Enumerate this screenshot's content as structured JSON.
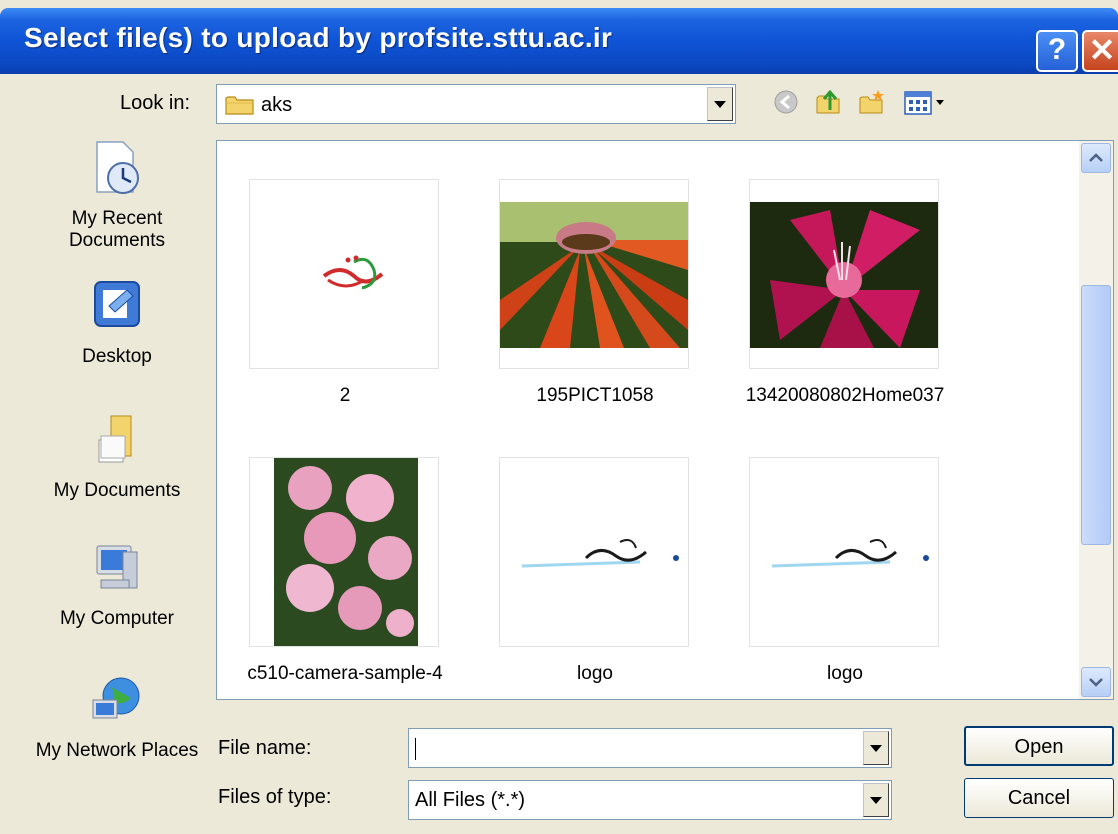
{
  "window": {
    "title": "Select file(s) to upload by profsite.sttu.ac.ir",
    "help_label": "?",
    "close_label": "✕"
  },
  "look_in": {
    "label": "Look in:",
    "value": "aks",
    "icon": "folder-icon"
  },
  "toolbar": {
    "icons": [
      "back-icon",
      "up-folder-icon",
      "new-folder-icon",
      "view-menu-icon"
    ]
  },
  "places": [
    {
      "label": "My Recent Documents",
      "icon": "recent-documents-icon"
    },
    {
      "label": "Desktop",
      "icon": "desktop-icon"
    },
    {
      "label": "My Documents",
      "icon": "my-documents-icon"
    },
    {
      "label": "My Computer",
      "icon": "my-computer-icon"
    },
    {
      "label": "My Network Places",
      "icon": "network-places-icon"
    }
  ],
  "files": [
    {
      "name": "2",
      "thumb": "logo-art"
    },
    {
      "name": "195PICT1058",
      "thumb": "orange-flower"
    },
    {
      "name": "13420080802Home037",
      "thumb": "pink-flower"
    },
    {
      "name": "c510-camera-sample-4",
      "thumb": "azalea"
    },
    {
      "name": "logo",
      "thumb": "logo-line"
    },
    {
      "name": "logo",
      "thumb": "logo-line"
    }
  ],
  "file_name": {
    "label": "File name:",
    "value": ""
  },
  "file_type": {
    "label": "Files of type:",
    "value": "All Files (*.*)"
  },
  "buttons": {
    "open": "Open",
    "cancel": "Cancel"
  },
  "colors": {
    "titlebar": "#0f54d6",
    "dialog_bg": "#ece9d8",
    "border": "#7f9db9"
  }
}
